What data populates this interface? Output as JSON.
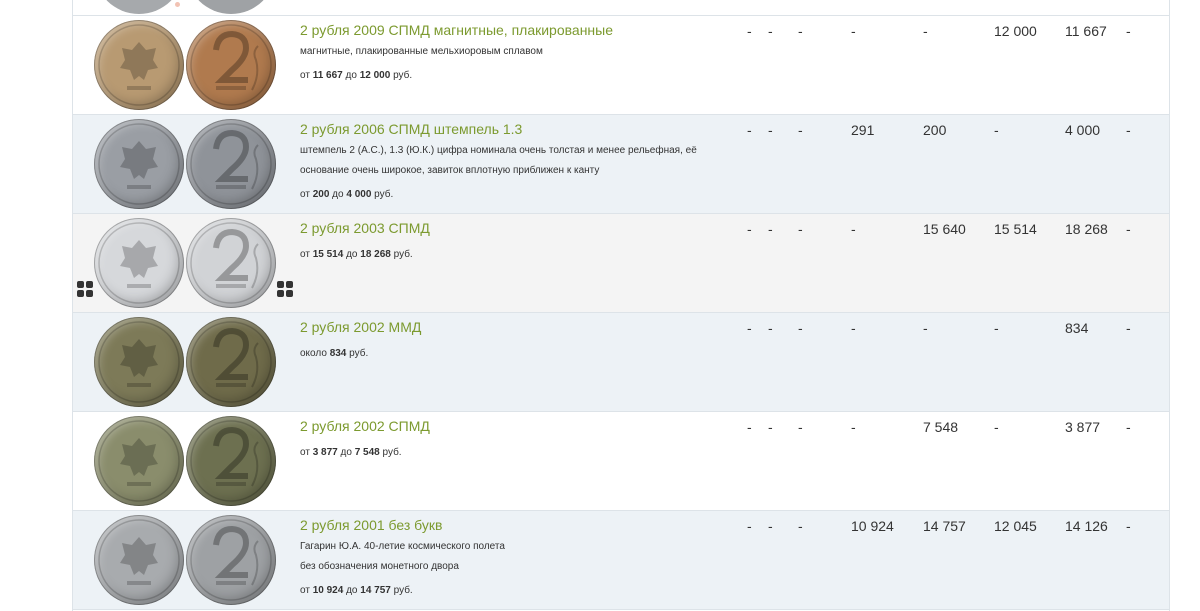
{
  "rows": [
    {
      "title": "2 рубля 2009 СПМД магнитные, плакированные",
      "desc": [
        "магнитные, плакированные мельхиоровым сплавом"
      ],
      "price": {
        "prefix": "от",
        "min": "11 667",
        "mid": "до",
        "max": "12 000",
        "suffix": "руб."
      },
      "cols": [
        "-",
        "-",
        "-",
        "-",
        "-",
        "12 000",
        "11 667",
        "-"
      ],
      "coin_colors": {
        "obverse": "#b89a72",
        "reverse": "#b07a4e"
      },
      "bg": "white"
    },
    {
      "title": "2 рубля 2006 СПМД штемпель 1.3",
      "desc": [
        "штемпель 2 (А.С.), 1.3 (Ю.К.) цифра номинала очень толстая и менее рельефная, её",
        "основание очень широкое, завиток вплотную приближен к канту"
      ],
      "price": {
        "prefix": "от",
        "min": "200",
        "mid": "до",
        "max": "4 000",
        "suffix": "руб."
      },
      "cols": [
        "-",
        "-",
        "-",
        "291",
        "200",
        "-",
        "4 000",
        "-"
      ],
      "coin_colors": {
        "obverse": "#9a9ea4",
        "reverse": "#8f9399"
      },
      "bg": "alt-blue"
    },
    {
      "title": "2 рубля 2003 СПМД",
      "desc": [],
      "price": {
        "prefix": "от",
        "min": "15 514",
        "mid": "до",
        "max": "18 268",
        "suffix": "руб."
      },
      "cols": [
        "-",
        "-",
        "-",
        "-",
        "15 640",
        "15 514",
        "18 268",
        "-"
      ],
      "coin_colors": {
        "obverse": "#d6d8db",
        "reverse": "#d1d3d6"
      },
      "bg": "alt-grey"
    },
    {
      "title": "2 рубля 2002 ММД",
      "desc": [],
      "price": {
        "prefix": "около",
        "min": "834",
        "mid": "",
        "max": "",
        "suffix": "руб."
      },
      "cols": [
        "-",
        "-",
        "-",
        "-",
        "-",
        "-",
        "834",
        "-"
      ],
      "coin_colors": {
        "obverse": "#7d7a58",
        "reverse": "#6f6b4a"
      },
      "bg": "alt-blue"
    },
    {
      "title": "2 рубля 2002 СПМД",
      "desc": [],
      "price": {
        "prefix": "от",
        "min": "3 877",
        "mid": "до",
        "max": "7 548",
        "suffix": "руб."
      },
      "cols": [
        "-",
        "-",
        "-",
        "-",
        "7 548",
        "-",
        "3 877",
        "-"
      ],
      "coin_colors": {
        "obverse": "#8a8d6c",
        "reverse": "#6d7050"
      },
      "bg": "white"
    },
    {
      "title": "2 рубля 2001 без букв",
      "desc": [
        "Гагарин Ю.А. 40-летие космического полета",
        "без обозначения монетного двора"
      ],
      "price": {
        "prefix": "от",
        "min": "10 924",
        "mid": "до",
        "max": "14 757",
        "suffix": "руб."
      },
      "cols": [
        "-",
        "-",
        "-",
        "10 924",
        "14 757",
        "12 045",
        "14 126",
        "-"
      ],
      "coin_colors": {
        "obverse": "#a8abae",
        "reverse": "#9ea1a4"
      },
      "bg": "alt-blue"
    }
  ]
}
